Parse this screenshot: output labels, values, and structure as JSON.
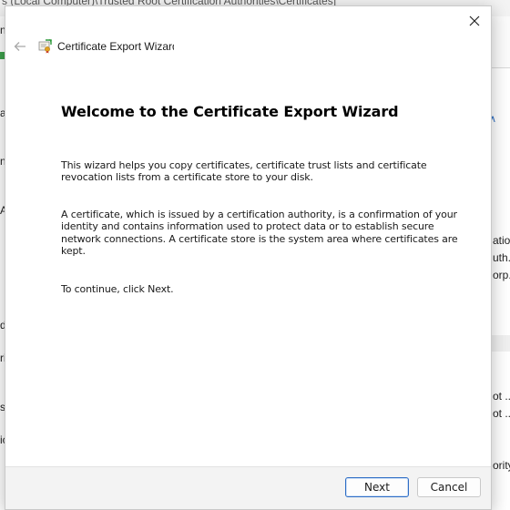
{
  "background_window": {
    "title_fragment": "s (Local Computer)\\Trusted Root Certification Authorities\\Certificates]",
    "left_fragments": [
      "n",
      "ac",
      "nc",
      "A",
      "d",
      "ri",
      "s",
      "ic"
    ],
    "right_fragments": [
      "atio..",
      "uth..",
      "orp.",
      "ot ..",
      "ot ..",
      "ority"
    ]
  },
  "dialog": {
    "title": "Certificate Export Wizard",
    "heading": "Welcome to the Certificate Export Wizard",
    "paragraph1": "This wizard helps you copy certificates, certificate trust lists and certificate revocation lists from a certificate store to your disk.",
    "paragraph2": "A certificate, which is issued by a certification authority, is a confirmation of your identity and contains information used to protect data or to establish secure network connections. A certificate store is the system area where certificates are kept.",
    "paragraph3": "To continue, click Next.",
    "next_label": "Next",
    "cancel_label": "Cancel",
    "icons": {
      "close": "close-icon",
      "back": "back-arrow-icon",
      "wizard": "certificate-icon"
    }
  }
}
